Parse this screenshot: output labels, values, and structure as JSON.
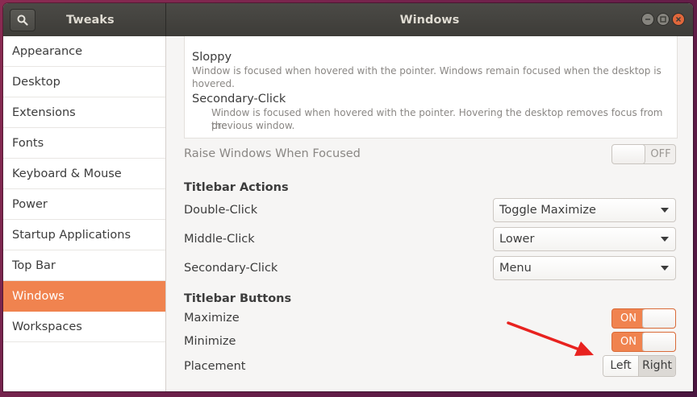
{
  "app": {
    "title": "Tweaks",
    "window_title": "Windows"
  },
  "colors": {
    "accent": "#f0834f",
    "arrow": "#e8221f",
    "titlebar": "#3d3c38"
  },
  "sidebar": {
    "items": [
      {
        "label": "Appearance"
      },
      {
        "label": "Desktop"
      },
      {
        "label": "Extensions"
      },
      {
        "label": "Fonts"
      },
      {
        "label": "Keyboard & Mouse"
      },
      {
        "label": "Power"
      },
      {
        "label": "Startup Applications"
      },
      {
        "label": "Top Bar"
      },
      {
        "label": "Windows",
        "selected": true
      },
      {
        "label": "Workspaces"
      }
    ]
  },
  "focus_modes": {
    "sloppy": {
      "title": "Sloppy",
      "desc": "Window is focused when hovered with the pointer. Windows remain focused when the desktop is hovered."
    },
    "secondary": {
      "title": "Secondary-Click",
      "desc_line1": "Window is focused when hovered with the pointer. Hovering the desktop removes focus from the",
      "desc_line2": "previous window."
    }
  },
  "raise": {
    "label": "Raise Windows When Focused",
    "state": "OFF"
  },
  "titlebar_actions": {
    "heading": "Titlebar Actions",
    "double_click": {
      "label": "Double-Click",
      "value": "Toggle Maximize"
    },
    "middle_click": {
      "label": "Middle-Click",
      "value": "Lower"
    },
    "secondary_click": {
      "label": "Secondary-Click",
      "value": "Menu"
    }
  },
  "titlebar_buttons": {
    "heading": "Titlebar Buttons",
    "maximize": {
      "label": "Maximize",
      "state": "ON"
    },
    "minimize": {
      "label": "Minimize",
      "state": "ON"
    },
    "placement": {
      "label": "Placement",
      "left": "Left",
      "right": "Right",
      "selected": "Right"
    }
  }
}
